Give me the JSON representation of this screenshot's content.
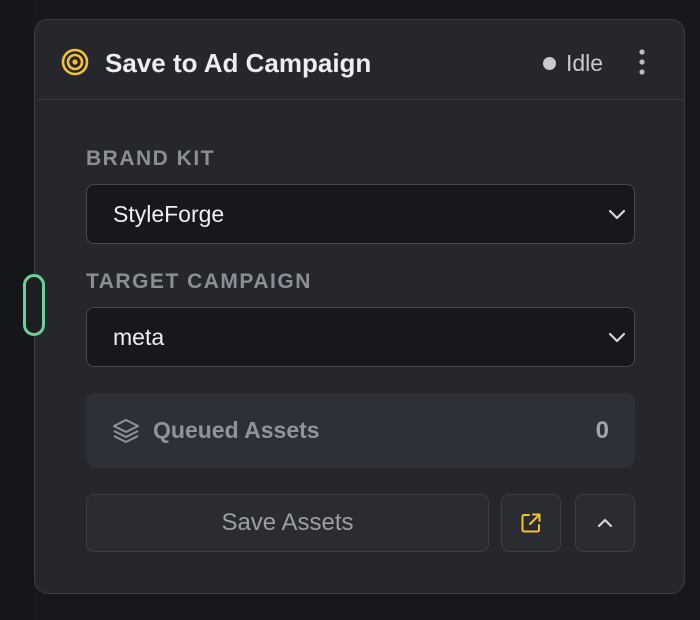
{
  "node": {
    "title": "Save to Ad Campaign",
    "header_icon": "target-icon",
    "status": {
      "text": "Idle",
      "dot_color": "#c7cacf"
    },
    "menu_icon": "more-vertical-icon"
  },
  "brand_kit": {
    "label": "BRAND KIT",
    "value": "StyleForge",
    "icon": "chevron-down-icon"
  },
  "target_campaign": {
    "label": "TARGET CAMPAIGN",
    "value": "meta",
    "icon": "chevron-down-icon"
  },
  "queued": {
    "icon": "layers-icon",
    "label": "Queued Assets",
    "count": "0"
  },
  "actions": {
    "save_label": "Save Assets",
    "open_icon": "external-link-icon",
    "collapse_icon": "chevron-up-icon"
  },
  "colors": {
    "accent_yellow": "#f2c230",
    "handle_green": "#6fcf97",
    "panel_bg": "#25272c"
  }
}
